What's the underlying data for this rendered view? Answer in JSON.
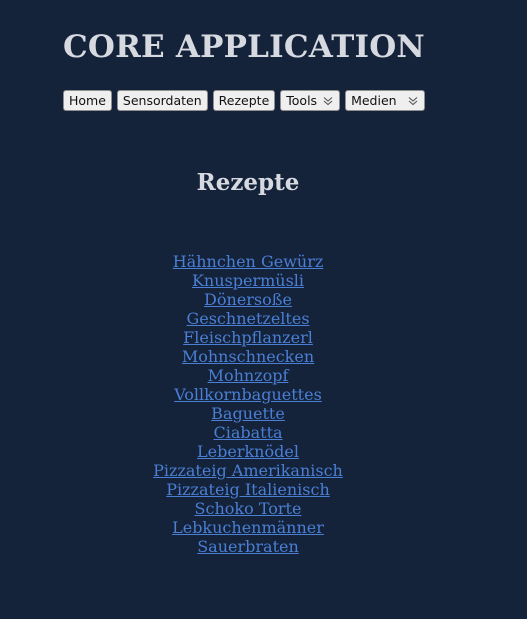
{
  "app": {
    "title": "CORE APPLICATION"
  },
  "nav": {
    "items": [
      {
        "label": "Home",
        "dropdown": false
      },
      {
        "label": "Sensordaten",
        "dropdown": false
      },
      {
        "label": "Rezepte",
        "dropdown": false
      },
      {
        "label": "Tools",
        "dropdown": true
      },
      {
        "label": "Medien",
        "dropdown": true
      }
    ],
    "dropdown_icon": "double-chevron-down-icon"
  },
  "page": {
    "heading": "Rezepte"
  },
  "recipes": [
    "Hähnchen Gewürz",
    "Knuspermüsli",
    "Dönersoße",
    "Geschnetzeltes",
    "Fleischpflanzerl",
    "Mohnschnecken",
    "Mohnzopf",
    "Vollkornbaguettes",
    "Baguette",
    "Ciabatta",
    "Leberknödel",
    "Pizzateig Amerikanisch",
    "Pizzateig Italienisch",
    "Schoko Torte",
    "Lebkuchenmänner",
    "Sauerbraten"
  ],
  "colors": {
    "background": "#14223a",
    "title_text": "#d6dae0",
    "link": "#4a7fd4",
    "button_bg": "#efefef"
  }
}
